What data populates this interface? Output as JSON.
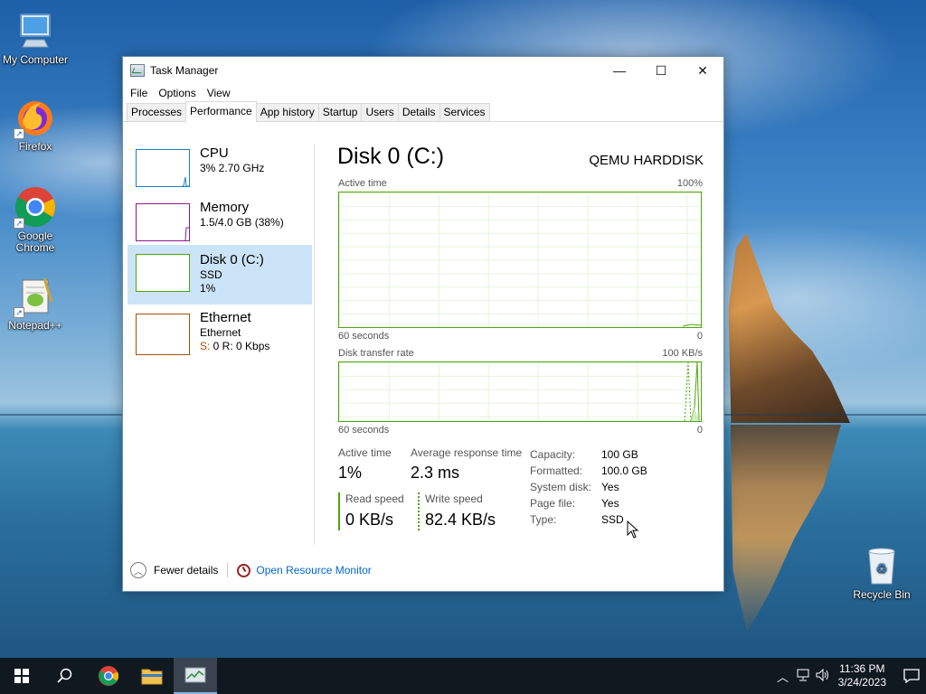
{
  "desktop": {
    "icons": [
      {
        "label": "My Computer"
      },
      {
        "label": "Firefox"
      },
      {
        "label": "Google Chrome"
      },
      {
        "label": "Notepad++"
      },
      {
        "label": "Recycle Bin"
      }
    ]
  },
  "window": {
    "title": "Task Manager",
    "buttons": {
      "minimize": "—",
      "maximize": "☐",
      "close": "✕"
    },
    "menu": [
      "File",
      "Options",
      "View"
    ],
    "tabs": [
      "Processes",
      "Performance",
      "App history",
      "Startup",
      "Users",
      "Details",
      "Services"
    ],
    "active_tab": "Performance"
  },
  "resources": [
    {
      "name": "CPU",
      "line1": "3%  2.70 GHz",
      "line2": "",
      "color": "#1d7ec2",
      "level": 0.03
    },
    {
      "name": "Memory",
      "line1": "1.5/4.0 GB (38%)",
      "line2": "",
      "color": "#8b1a8e",
      "level": 0.38
    },
    {
      "name": "Disk 0 (C:)",
      "line1": "SSD",
      "line2": "1%",
      "color": "#4da60c",
      "level": 0.01,
      "selected": true
    },
    {
      "name": "Ethernet",
      "line1": "Ethernet",
      "line2a": "S: ",
      "line2b": "0  R: 0 Kbps",
      "color": "#a74f01",
      "level": 0
    }
  ],
  "detail": {
    "title": "Disk 0 (C:)",
    "model": "QEMU HARDDISK",
    "graph1": {
      "label": "Active time",
      "max": "100%",
      "xlabel": "60 seconds",
      "min": "0"
    },
    "graph2": {
      "label": "Disk transfer rate",
      "max": "100 KB/s",
      "xlabel": "60 seconds",
      "min": "0"
    },
    "stats": {
      "active_time_label": "Active time",
      "active_time": "1%",
      "avg_response_label": "Average response time",
      "avg_response": "2.3 ms",
      "read_speed_label": "Read speed",
      "read_speed": "0 KB/s",
      "write_speed_label": "Write speed",
      "write_speed": "82.4 KB/s"
    },
    "props": [
      {
        "key": "Capacity:",
        "value": "100 GB"
      },
      {
        "key": "Formatted:",
        "value": "100.0 GB"
      },
      {
        "key": "System disk:",
        "value": "Yes"
      },
      {
        "key": "Page file:",
        "value": "Yes"
      },
      {
        "key": "Type:",
        "value": "SSD"
      }
    ]
  },
  "footer": {
    "fewer_details": "Fewer details",
    "open_resource_monitor": "Open Resource Monitor"
  },
  "taskbar": {
    "time": "11:36 PM",
    "date": "3/24/2023"
  }
}
